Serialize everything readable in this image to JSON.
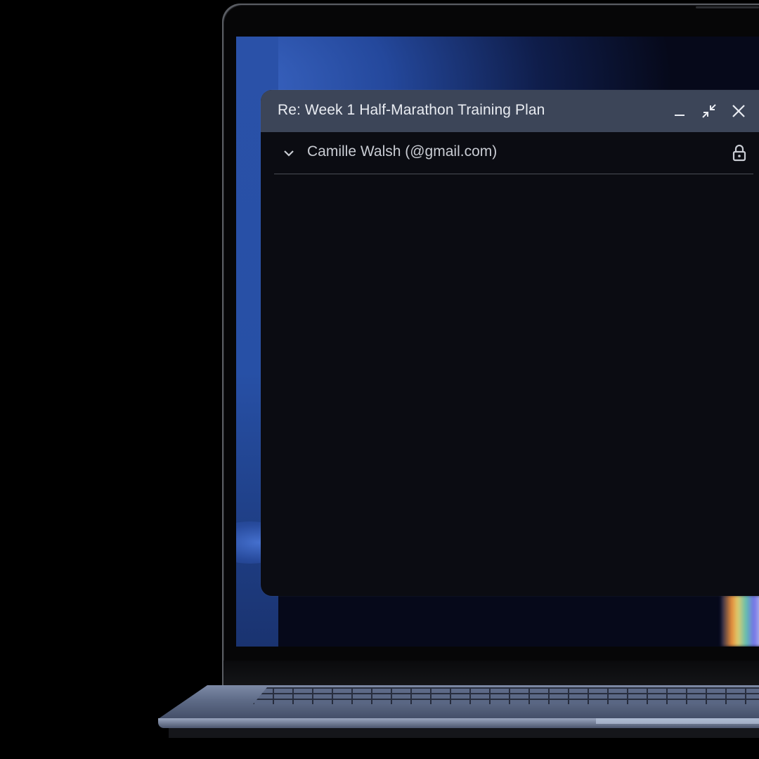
{
  "window": {
    "title": "Re: Week 1 Half-Marathon Training Plan",
    "recipient": "Camille Walsh (@gmail.com)",
    "controls": {
      "minimize_icon": "minimize-icon",
      "shrink_icon": "exit-fullscreen-icon",
      "close_icon": "close-icon"
    },
    "recipient_icons": {
      "expand_icon": "chevron-down-icon",
      "lock_icon": "lock-icon"
    }
  },
  "colors": {
    "titlebar": "#3c4558",
    "window_body": "#0b0c12",
    "title_text": "#e9ecf2",
    "recipient_text": "#c9ccd3",
    "divider": "#4a4d55",
    "wallpaper_blue": "#2750a6"
  }
}
